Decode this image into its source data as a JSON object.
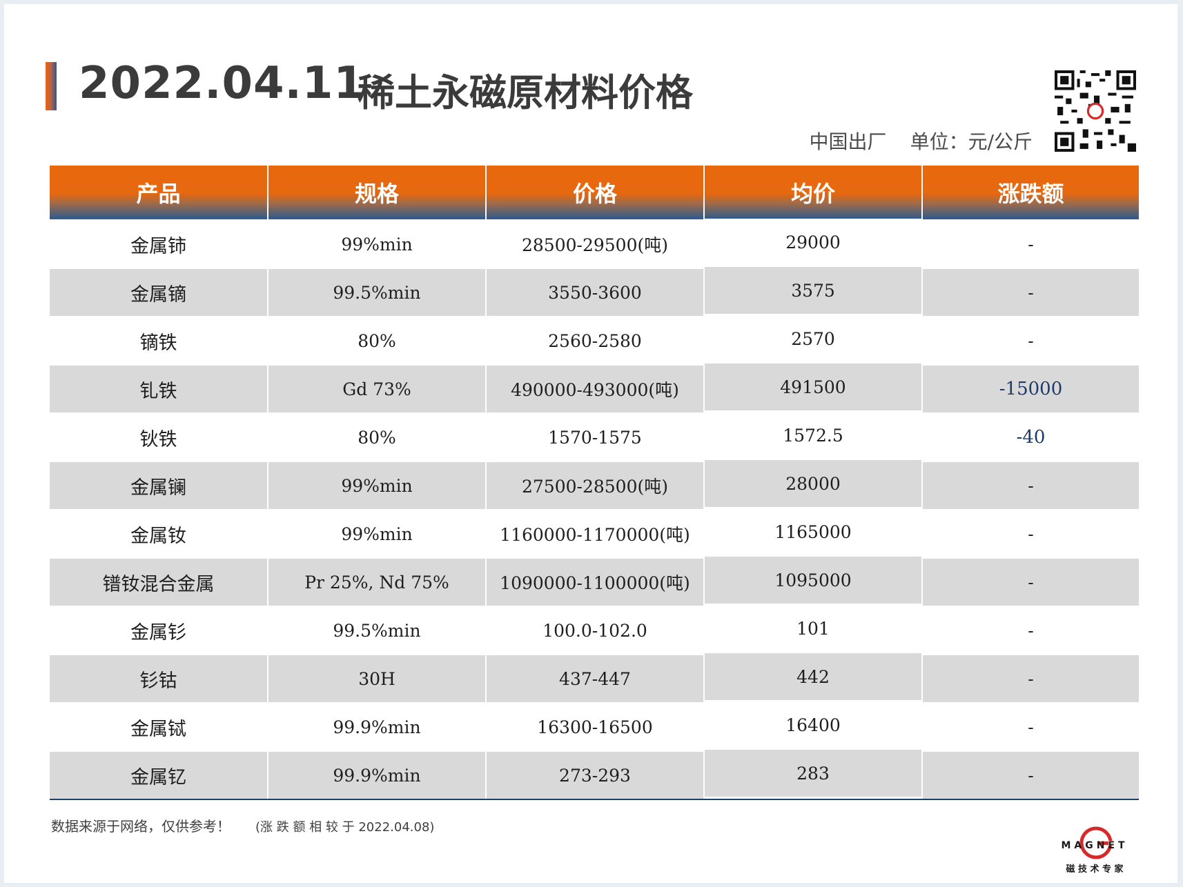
{
  "header": {
    "date": "2022.04.11",
    "title": "稀土永磁原材料价格",
    "origin": "中国出厂",
    "unit": "单位：元/公斤"
  },
  "table": {
    "columns": [
      "产品",
      "规格",
      "价格",
      "均价",
      "涨跌额"
    ],
    "rows": [
      {
        "product": "金属铈",
        "spec": "99%min",
        "price": "28500-29500(吨)",
        "avg": "29000",
        "change": "-"
      },
      {
        "product": "金属镝",
        "spec": "99.5%min",
        "price": "3550-3600",
        "avg": "3575",
        "change": "-"
      },
      {
        "product": "镝铁",
        "spec": "80%",
        "price": "2560-2580",
        "avg": "2570",
        "change": "-"
      },
      {
        "product": "钆铁",
        "spec": "Gd 73%",
        "price": "490000-493000(吨)",
        "avg": "491500",
        "change": "-15000"
      },
      {
        "product": "钬铁",
        "spec": "80%",
        "price": "1570-1575",
        "avg": "1572.5",
        "change": "-40"
      },
      {
        "product": "金属镧",
        "spec": "99%min",
        "price": "27500-28500(吨)",
        "avg": "28000",
        "change": "-"
      },
      {
        "product": "金属钕",
        "spec": "99%min",
        "price": "1160000-1170000(吨)",
        "avg": "1165000",
        "change": "-"
      },
      {
        "product": "镨钕混合金属",
        "spec": "Pr 25%, Nd 75%",
        "price": "1090000-1100000(吨)",
        "avg": "1095000",
        "change": "-"
      },
      {
        "product": "金属钐",
        "spec": "99.5%min",
        "price": "100.0-102.0",
        "avg": "101",
        "change": "-"
      },
      {
        "product": "钐钴",
        "spec": "30H",
        "price": "437-447",
        "avg": "442",
        "change": "-"
      },
      {
        "product": "金属铽",
        "spec": "99.9%min",
        "price": "16300-16500",
        "avg": "16400",
        "change": "-"
      },
      {
        "product": "金属钇",
        "spec": "99.9%min",
        "price": "273-293",
        "avg": "283",
        "change": "-"
      }
    ]
  },
  "footer": {
    "source_note": "数据来源于网络，仅供参考！",
    "compare_note": "(涨 跌 额 相 较 于 2022.04.08)",
    "logo_text": "MAGNET",
    "logo_subtext": "磁 技 术 专 家"
  },
  "colors": {
    "header_orange": "#e9680e",
    "header_blue": "#2b5a8e",
    "row_alt": "#d9d9d9",
    "negative_change": "#1f3a68",
    "logo_red": "#d62a2a"
  }
}
